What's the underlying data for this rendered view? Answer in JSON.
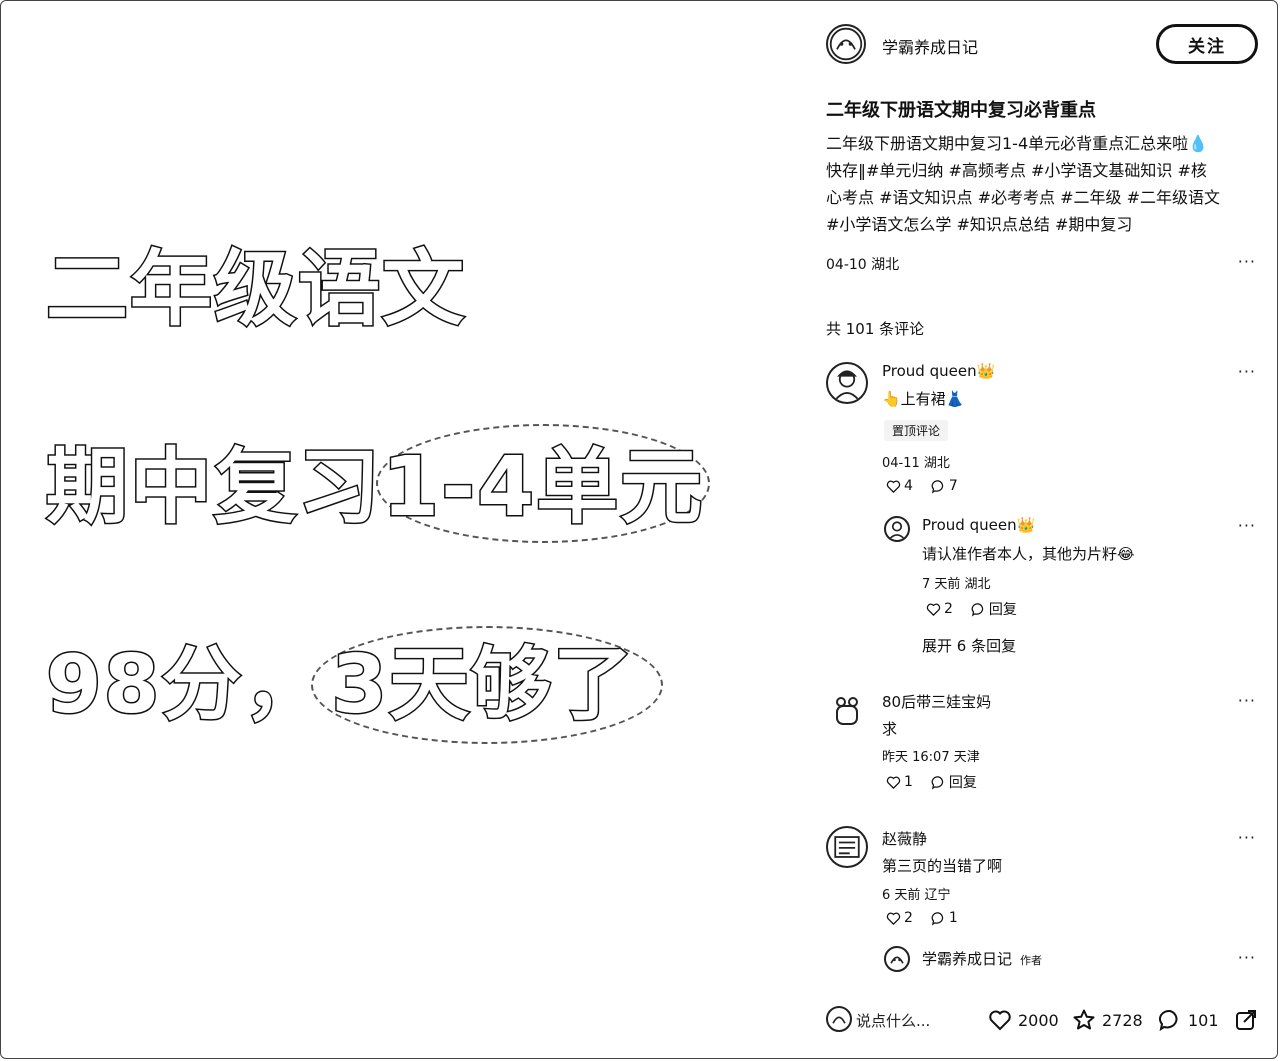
{
  "image": {
    "line1": "二年级语文",
    "line2_a": "期中复习",
    "line2_b": "1-4单元",
    "line3_a": "98分，",
    "line3_b": "3天够了"
  },
  "author": {
    "name": "学霸养成日记",
    "follow_label": "关注"
  },
  "post": {
    "title": "二年级下册语文期中复习必背重点",
    "desc_lines": [
      "二年级下册语文期中复习1-4单元必背重点汇总来啦💧",
      "快存‖#单元归纳 #高频考点 #小学语文基础知识 #核",
      "心考点 #语文知识点 #必考考点 #二年级 #二年级语文",
      "#小学语文怎么学 #知识点总结 #期中复习"
    ],
    "meta": "04-10 湖北",
    "comment_count": "共 101 条评论"
  },
  "comments": [
    {
      "name": "Proud queen👑",
      "text": "👆上有裙👗",
      "badge": "置顶评论",
      "meta": "04-11 湖北",
      "likes": "4",
      "replies": "7",
      "reply": {
        "name": "Proud queen👑",
        "text": "请认准作者本人，其他为片籽😂",
        "meta": "7 天前 湖北",
        "likes": "2",
        "reply_label": "回复"
      },
      "expand": "展开 6 条回复"
    },
    {
      "name": "80后带三娃宝妈",
      "text": "求",
      "meta": "昨天 16:07 天津",
      "likes": "1",
      "reply_label": "回复"
    },
    {
      "name": "赵薇静",
      "text": "第三页的当错了啊",
      "meta": "6 天前 辽宁",
      "likes": "2",
      "replies": "1",
      "reply": {
        "name": "学霸养成日记",
        "tag": "作者"
      }
    }
  ],
  "bottom": {
    "placeholder": "说点什么...",
    "likes": "2000",
    "stars": "2728",
    "comments": "101"
  },
  "more_glyph": "···"
}
